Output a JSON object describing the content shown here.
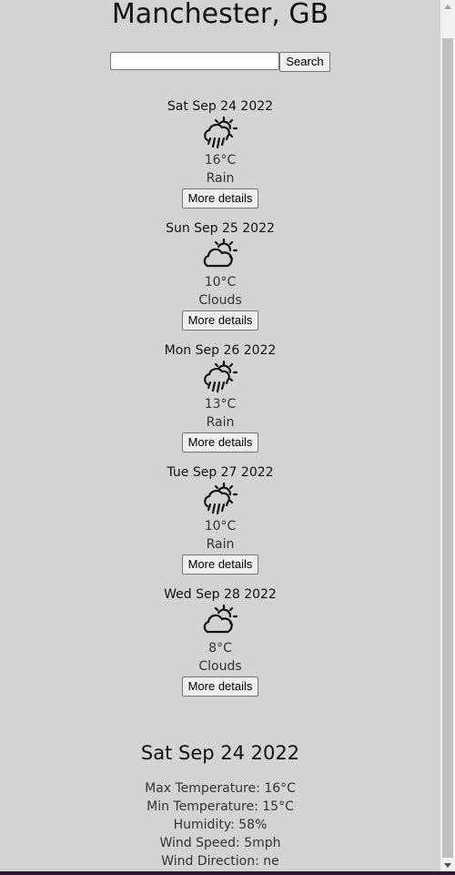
{
  "city": "Manchester, GB",
  "search": {
    "placeholder": "",
    "value": "",
    "button_label": "Search"
  },
  "forecast": [
    {
      "date": "Sat Sep 24 2022",
      "icon": "rain-sun-icon",
      "temp": "16°C",
      "condition": "Rain",
      "button_label": "More details"
    },
    {
      "date": "Sun Sep 25 2022",
      "icon": "cloud-sun-icon",
      "temp": "10°C",
      "condition": "Clouds",
      "button_label": "More details"
    },
    {
      "date": "Mon Sep 26 2022",
      "icon": "rain-sun-icon",
      "temp": "13°C",
      "condition": "Rain",
      "button_label": "More details"
    },
    {
      "date": "Tue Sep 27 2022",
      "icon": "rain-sun-icon",
      "temp": "10°C",
      "condition": "Rain",
      "button_label": "More details"
    },
    {
      "date": "Wed Sep 28 2022",
      "icon": "cloud-sun-icon",
      "temp": "8°C",
      "condition": "Clouds",
      "button_label": "More details"
    }
  ],
  "details": {
    "title": "Sat Sep 24 2022",
    "lines": [
      "Max Temperature: 16°C",
      "Min Temperature: 15°C",
      "Humidity: 58%",
      "Wind Speed: 5mph",
      "Wind Direction: ne"
    ]
  },
  "colors": {
    "background": "#d3d3d3",
    "text": "#111111",
    "button_bg": "#efefef"
  }
}
